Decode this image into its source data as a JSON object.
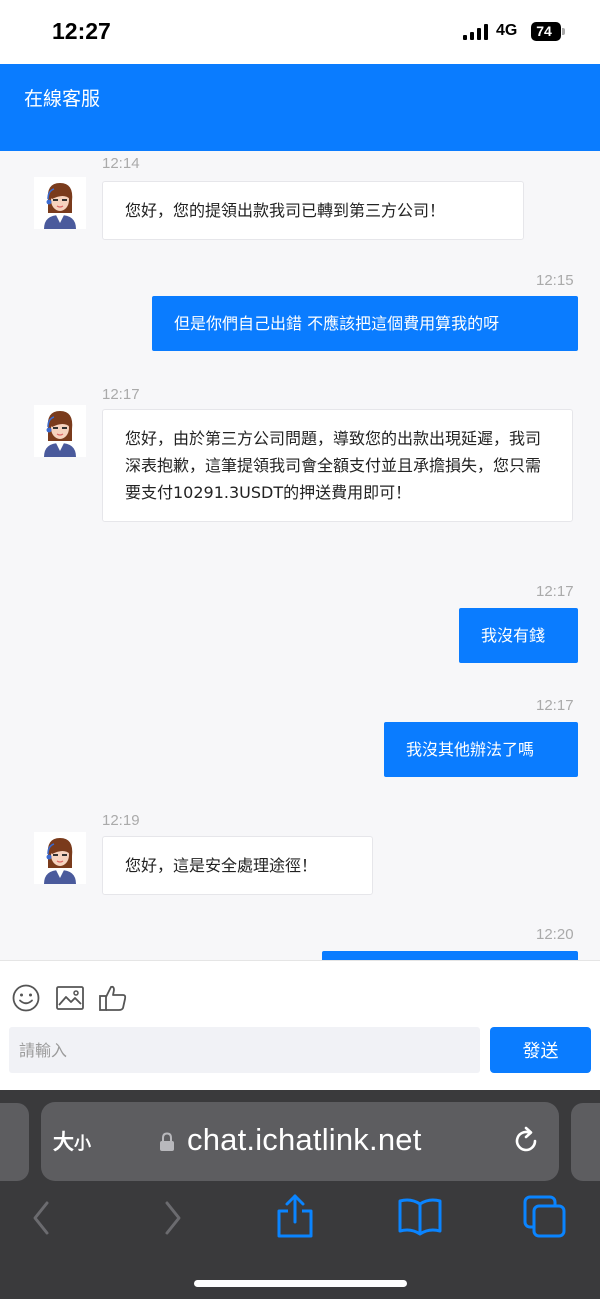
{
  "status_bar": {
    "time": "12:27",
    "network": "4G",
    "battery": "74"
  },
  "header": {
    "title": "在線客服"
  },
  "messages": [
    {
      "time": "12:14",
      "direction": "in",
      "text": "您好，您的提領出款我司已轉到第三方公司！"
    },
    {
      "time": "12:15",
      "direction": "out",
      "text": "但是你們自己出錯 不應該把這個費用算我的呀"
    },
    {
      "time": "12:17",
      "direction": "in",
      "text": "您好，由於第三方公司問題，導致您的出款出現延遲，我司深表抱歉，這筆提領我司會全額支付並且承擔損失，您只需要支付10291.3USDT的押送費用即可！"
    },
    {
      "time": "12:17",
      "direction": "out",
      "text": "我沒有錢"
    },
    {
      "time": "12:17",
      "direction": "out",
      "text": "我沒其他辦法了嗎"
    },
    {
      "time": "12:19",
      "direction": "in",
      "text": "您好，這是安全處理途徑！"
    },
    {
      "time": "12:20",
      "direction": "out",
      "text": ""
    }
  ],
  "composer": {
    "tools": [
      "smiley-icon",
      "image-icon",
      "thumbs-up-icon"
    ],
    "input_placeholder": "請輸入",
    "input_value": "",
    "send_label": "發送"
  },
  "browser": {
    "text_size_big": "大",
    "text_size_small": "小",
    "url": "chat.ichatlink.net",
    "icons": [
      "back-icon",
      "forward-icon",
      "share-icon",
      "bookmarks-icon",
      "tabs-icon",
      "reload-icon",
      "lock-icon"
    ]
  },
  "colors": {
    "accent": "#0a7cff",
    "chat_bg": "#f7f7f9",
    "browser_bg": "#3a3a3c"
  }
}
